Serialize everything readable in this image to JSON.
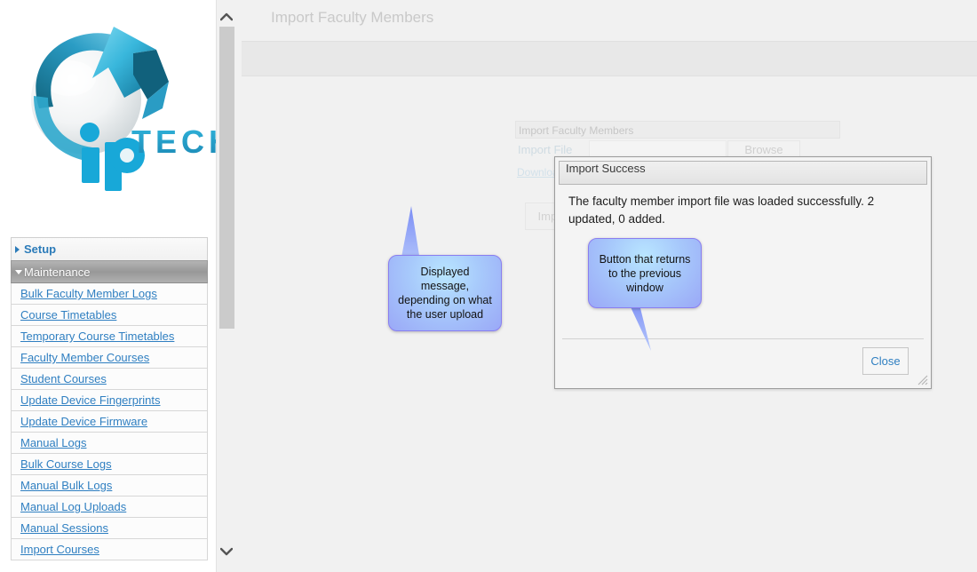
{
  "sidebar": {
    "logo": {
      "icon": "iptech-logo",
      "text": "TECH"
    },
    "groups": [
      {
        "label": "Setup",
        "icon": "chevron-right-icon",
        "expanded": false
      },
      {
        "label": "Maintenance",
        "icon": "chevron-down-icon",
        "expanded": true
      }
    ],
    "items": [
      {
        "label": "Bulk Faculty Member Logs"
      },
      {
        "label": "Course Timetables"
      },
      {
        "label": "Temporary Course Timetables"
      },
      {
        "label": "Faculty Member Courses"
      },
      {
        "label": "Student Courses"
      },
      {
        "label": "Update Device Fingerprints"
      },
      {
        "label": "Update Device Firmware"
      },
      {
        "label": "Manual Logs"
      },
      {
        "label": "Bulk Course Logs"
      },
      {
        "label": "Manual Bulk Logs"
      },
      {
        "label": "Manual Log Uploads"
      },
      {
        "label": "Manual Sessions"
      },
      {
        "label": "Import Courses"
      }
    ]
  },
  "scrollbar": {
    "up_icon": "chevron-up-icon",
    "down_icon": "chevron-down-icon"
  },
  "main": {
    "page_title": "Import Faculty Members",
    "form": {
      "panel_header": "Import Faculty Members",
      "import_file_label": "Import File",
      "import_file_value": "",
      "browse_label": "Browse",
      "download_link": "Downloa",
      "import_label": "Impo"
    }
  },
  "modal": {
    "title": "Import Success",
    "message": "The faculty member import file was loaded successfully. 2 updated, 0 added.",
    "close_label": "Close",
    "resize_icon": "resize-grip-icon"
  },
  "annotations": [
    {
      "id": "message-callout",
      "text": "Displayed message, depending on what the user upload"
    },
    {
      "id": "close-callout",
      "text": "Button that returns to the previous window"
    }
  ],
  "colors": {
    "link": "#2f7fc1",
    "callout_border": "#8a7ef0",
    "callout_fill": "#a7c9fb",
    "accent_teal": "#2cb4d8",
    "menu_active": "#989898"
  }
}
